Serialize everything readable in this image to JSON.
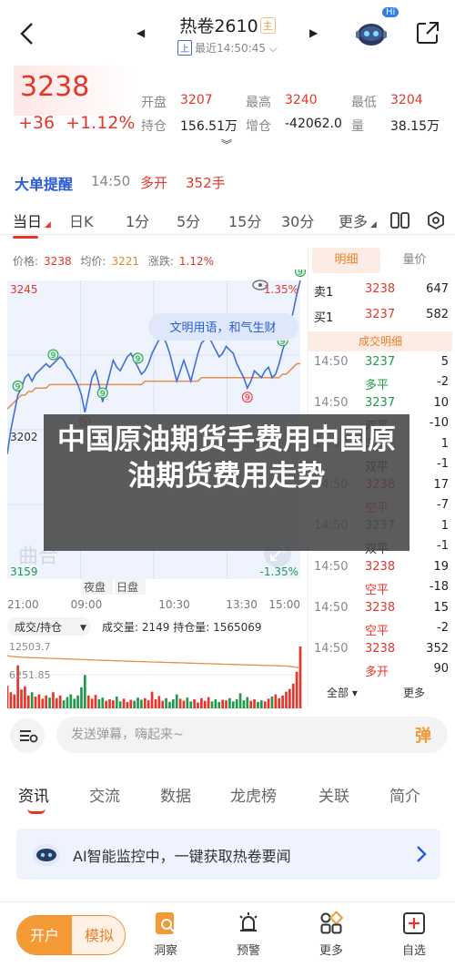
{
  "header": {
    "title": "热卷2610",
    "title_tag": "主",
    "subtitle_badge": "上",
    "subtitle": "最近14:50:45",
    "robot_badge": "Hi"
  },
  "quote": {
    "last": "3238",
    "change": "+36",
    "change_pct": "+1.12%",
    "fields": [
      {
        "label": "开盘",
        "value": "3207",
        "color": "red"
      },
      {
        "label": "最高",
        "value": "3240",
        "color": "red"
      },
      {
        "label": "最低",
        "value": "3204",
        "color": "red"
      },
      {
        "label": "持仓",
        "value": "156.51万",
        "color": "dark"
      },
      {
        "label": "增仓",
        "value": "-42062.0",
        "color": "dark"
      },
      {
        "label": "量",
        "value": "38.15万",
        "color": "dark"
      }
    ]
  },
  "big_order": {
    "label": "大单提醒",
    "time": "14:50",
    "action": "多开",
    "qty": "352手"
  },
  "tabs": [
    "当日",
    "日K",
    "1分",
    "5分",
    "15分",
    "30分",
    "更多"
  ],
  "chart_info": {
    "price_label": "价格:",
    "price": "3238",
    "avg_label": "均价:",
    "avg": "3221",
    "chg_label": "涨跌:",
    "chg": "1.12%"
  },
  "chart_labels": {
    "high": "3245",
    "high_pct": "1.35%",
    "mid": "3202",
    "low": "3159",
    "low_pct": "-1.35%",
    "times": [
      "21:00",
      "09:00",
      "10:30",
      "13:30",
      "15:00"
    ],
    "session_tags": [
      "夜盘",
      "日盘"
    ],
    "tooltip": "文明用语，和气生财",
    "watermark": "曲合",
    "vol_selector": "成交/持仓",
    "volume_text": "成交量: 2149  持仓量: 1565069",
    "vol_high": "12503.7",
    "vol_low": "6251.85"
  },
  "chart_data": {
    "type": "line",
    "x_label_ticks": [
      "21:00",
      "09:00",
      "10:30",
      "13:30",
      "15:00"
    ],
    "ylim": [
      3159,
      3245
    ],
    "series": [],
    "price_values": [
      3195,
      3202,
      3207,
      3212,
      3214,
      3217,
      3218,
      3216,
      3218,
      3219,
      3220,
      3221,
      3220,
      3221,
      3222,
      3223,
      3222,
      3220,
      3219,
      3217,
      3215,
      3212,
      3207,
      3212,
      3217,
      3219,
      3215,
      3210,
      3214,
      3218,
      3222,
      3220,
      3219,
      3221,
      3223,
      3224,
      3222,
      3220,
      3218,
      3219,
      3221,
      3224,
      3226,
      3228,
      3229,
      3227,
      3224,
      3220,
      3216,
      3219,
      3222,
      3219,
      3216,
      3220,
      3224,
      3227,
      3228,
      3229,
      3227,
      3225,
      3223,
      3224,
      3226,
      3225,
      3224,
      3221,
      3219,
      3217,
      3214,
      3216,
      3219,
      3218,
      3217,
      3219,
      3220,
      3217,
      3218,
      3221,
      3225,
      3228,
      3232,
      3236,
      3241,
      3245
    ],
    "avg_values": [
      3208,
      3209,
      3210,
      3211,
      3212,
      3212,
      3213,
      3213,
      3214,
      3214,
      3214,
      3214,
      3215,
      3215,
      3215,
      3215,
      3215,
      3215,
      3215,
      3215,
      3215,
      3215,
      3215,
      3215,
      3215,
      3215,
      3215,
      3215,
      3215,
      3215,
      3215,
      3215,
      3215,
      3215,
      3215,
      3215,
      3215,
      3215,
      3215,
      3216,
      3216,
      3216,
      3216,
      3216,
      3216,
      3216,
      3216,
      3216,
      3216,
      3216,
      3216,
      3216,
      3216,
      3216,
      3216,
      3217,
      3217,
      3217,
      3217,
      3217,
      3217,
      3217,
      3217,
      3217,
      3217,
      3217,
      3217,
      3217,
      3217,
      3217,
      3217,
      3217,
      3217,
      3217,
      3217,
      3217,
      3217,
      3217,
      3218,
      3218,
      3219,
      3220,
      3221,
      3221
    ],
    "volume_values": [
      4200,
      3000,
      2600,
      8000,
      3500,
      4100,
      2400,
      3000,
      2200,
      2600,
      1800,
      2400,
      2000,
      3000,
      1900,
      2400,
      1500,
      2100,
      2600,
      1800,
      2400,
      3900,
      6200,
      2400,
      1800,
      2500,
      1700,
      2000,
      1400,
      1700,
      1500,
      2200,
      1300,
      1800,
      1200,
      1600,
      1400,
      2000,
      1600,
      1900,
      1500,
      3100,
      1700,
      2300,
      1400,
      1900,
      1200,
      1700,
      2600,
      1800,
      1400,
      2000,
      1300,
      1700,
      1100,
      1900,
      1400,
      2100,
      1300,
      1700,
      1200,
      1600,
      1500,
      1900,
      1300,
      1700,
      2800,
      1500,
      2100,
      1400,
      1700,
      1200,
      1500,
      1300,
      1800,
      2200,
      2600,
      1900,
      2400,
      3100,
      3600,
      4600,
      6800,
      11500
    ],
    "oi_values": [
      9800,
      9650,
      9600,
      9550,
      9500,
      9480,
      9450,
      9420,
      9400,
      9380,
      9350,
      9320,
      9300,
      9280,
      9250,
      9230,
      9200,
      9180,
      9150,
      9120,
      9100,
      9080,
      9050,
      9020,
      9000,
      8980,
      8950,
      8920,
      8900,
      8880,
      8850,
      8830,
      8800,
      8780,
      8750,
      8740,
      8720,
      8700,
      8680,
      8660,
      8640,
      8620,
      8600,
      8580,
      8560,
      8540,
      8520,
      8500,
      8480,
      8460,
      8440,
      8420,
      8400,
      8380,
      8360,
      8340,
      8320,
      8300,
      8280,
      8260,
      8240,
      8220,
      8200,
      8180,
      8160,
      8140,
      8120,
      8100,
      8080,
      8060,
      8040,
      8020,
      8000,
      7980,
      7960,
      7940,
      7920,
      7900,
      7880,
      7860,
      7800,
      7700,
      7600,
      7500
    ]
  },
  "right_panel": {
    "tab_detail": "明细",
    "tab_price": "量价",
    "sell1_label": "卖1",
    "sell1_price": "3238",
    "sell1_vol": "647",
    "buy1_label": "买1",
    "buy1_price": "3237",
    "buy1_vol": "582",
    "section_title": "成交明细",
    "trades": [
      {
        "time": "14:50",
        "price": "3237",
        "price_color": "green",
        "vol": "5",
        "type": "多平",
        "type_color": "green",
        "chg": "-2"
      },
      {
        "time": "14:50",
        "price": "3237",
        "price_color": "green",
        "vol": "10",
        "type": "双平",
        "type_color": "dark",
        "chg": "-10"
      },
      {
        "time": "14:50",
        "price": "3237",
        "price_color": "green",
        "vol": "1",
        "type": "双平",
        "type_color": "dark",
        "chg": "-1"
      },
      {
        "time": "14:50",
        "price": "3238",
        "price_color": "red",
        "vol": "17",
        "type": "空平",
        "type_color": "red",
        "chg": "-7"
      },
      {
        "time": "14:50",
        "price": "3237",
        "price_color": "green",
        "vol": "1",
        "type": "双平",
        "type_color": "dark",
        "chg": "-1"
      },
      {
        "time": "14:50",
        "price": "3238",
        "price_color": "red",
        "vol": "19",
        "type": "空平",
        "type_color": "red",
        "chg": "-18"
      },
      {
        "time": "14:50",
        "price": "3238",
        "price_color": "red",
        "vol": "15",
        "type": "空平",
        "type_color": "red",
        "chg": "-2"
      },
      {
        "time": "14:50",
        "price": "3238",
        "price_color": "red",
        "vol": "352",
        "type": "多开",
        "type_color": "red",
        "chg": "90"
      }
    ],
    "all_label": "全部",
    "more_label": "更多"
  },
  "overlay": {
    "text": "中国原油期货手费用中国原油期货费用走势"
  },
  "comment": {
    "placeholder": "发送弹幕，嗨起来~",
    "danmu": "弹"
  },
  "info_tabs": [
    "资讯",
    "交流",
    "数据",
    "龙虎榜",
    "关联",
    "简介"
  ],
  "ai_card": {
    "text": "AI智能监控中，一键获取热卷要闻"
  },
  "bottom": {
    "open": "开户",
    "sim": "模拟",
    "items": [
      "洞察",
      "预警",
      "更多",
      "自选"
    ]
  },
  "colors": {
    "up": "#e8352a",
    "down": "#1f9a4b",
    "price_line": "#3f6fd8",
    "avg_line": "#e0904a",
    "accent_blue": "#2a5bd7",
    "orange": "#f39a35"
  }
}
